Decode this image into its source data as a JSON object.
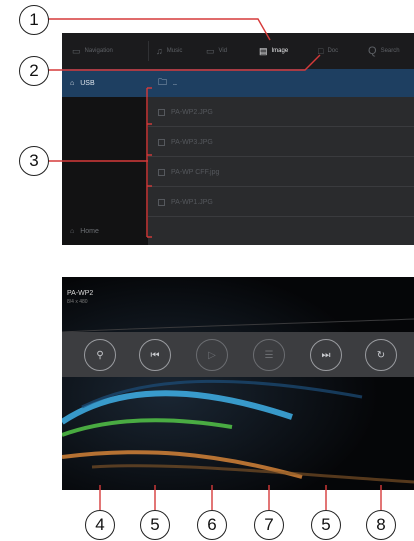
{
  "screen1": {
    "tabs": [
      {
        "label": "Navigation",
        "icon": "navigation-icon"
      },
      {
        "label": "Music",
        "icon": "music-icon"
      },
      {
        "label": "Vid",
        "icon": "video-icon"
      },
      {
        "label": "Image",
        "icon": "image-icon",
        "active": true
      },
      {
        "label": "Doc",
        "icon": "document-icon"
      },
      {
        "label": "Search",
        "icon": "search-icon"
      }
    ],
    "sidebar": {
      "usb_label": "USB",
      "home_label": "Home"
    },
    "files": [
      {
        "name": "..",
        "selected": true
      },
      {
        "name": "PA-WP2.JPG"
      },
      {
        "name": "PA-WP3.JPG"
      },
      {
        "name": "PA-WP CFF.jpg"
      },
      {
        "name": "PA-WP1.JPG"
      }
    ]
  },
  "screen2": {
    "title": "PA-WP2",
    "subtitle": "8/4 x 480",
    "controls": [
      {
        "name": "zoom-button",
        "icon": "zoom-icon",
        "glyph": "⚲"
      },
      {
        "name": "previous-button",
        "icon": "skip-previous-icon",
        "glyph": "⏮"
      },
      {
        "name": "play-button",
        "icon": "play-icon",
        "glyph": "▷"
      },
      {
        "name": "list-button",
        "icon": "list-icon",
        "glyph": "☰"
      },
      {
        "name": "next-button",
        "icon": "skip-next-icon",
        "glyph": "⏭"
      },
      {
        "name": "rotate-button",
        "icon": "rotate-icon",
        "glyph": "↻"
      }
    ]
  },
  "callouts": {
    "c1": "1",
    "c2": "2",
    "c3": "3",
    "c4": "4",
    "c5a": "5",
    "c6": "6",
    "c7": "7",
    "c5b": "5",
    "c8": "8"
  },
  "colors": {
    "accent": "#1e3f61",
    "background": "#232325",
    "bar": "#3c3d40"
  }
}
